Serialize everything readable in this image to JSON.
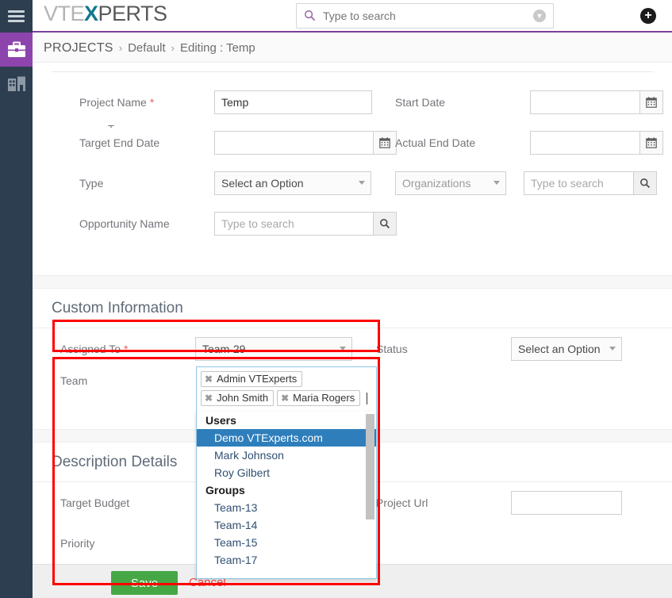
{
  "app": {
    "logo_part1": "VTE",
    "logo_x": "X",
    "logo_part2": "PERTS"
  },
  "header": {
    "search_placeholder": "Type to search",
    "search_value": "",
    "search_icon": "search-icon",
    "dropdown_icon": "chevron-down-circle-icon",
    "add_icon": "plus-circle-icon"
  },
  "sidebar": {
    "menu_icon": "hamburger-menu-icon",
    "items": [
      {
        "name": "projects",
        "icon": "briefcase-icon",
        "active": true
      },
      {
        "name": "organizations",
        "icon": "building-icon",
        "active": false
      }
    ]
  },
  "breadcrumb": {
    "module": "PROJECTS",
    "sep": "›",
    "view": "Default",
    "action": "Editing : Temp"
  },
  "form": {
    "cut_off_label": "T",
    "basic": [
      {
        "left": {
          "label": "Project Name",
          "required": true,
          "type": "text",
          "value": "Temp",
          "placeholder": ""
        },
        "right": {
          "label": "Start Date",
          "required": false,
          "type": "date",
          "value": "",
          "placeholder": "",
          "addon_icon": "calendar-icon"
        }
      },
      {
        "left": {
          "label": "Target End Date",
          "required": false,
          "type": "date",
          "value": "",
          "placeholder": "",
          "addon_icon": "calendar-icon"
        },
        "right": {
          "label": "Actual End Date",
          "required": false,
          "type": "date",
          "value": "",
          "placeholder": "",
          "addon_icon": "calendar-icon"
        }
      },
      {
        "left": {
          "label": "Type",
          "required": false,
          "type": "select",
          "value": "Select an Option"
        },
        "right": {
          "label": "",
          "required": false,
          "type": "module-search",
          "module_value": "Organizations",
          "placeholder": "Type to search",
          "addon_icon": "search-icon"
        }
      },
      {
        "left": {
          "label": "Opportunity Name",
          "required": false,
          "type": "search",
          "value": "",
          "placeholder": "Type to search",
          "addon_icon": "search-icon"
        },
        "right": null
      }
    ]
  },
  "custom_section": {
    "title": "Custom Information",
    "assigned_to": {
      "label": "Assigned To",
      "required": true,
      "value": "Team-29"
    },
    "status": {
      "label": "Status",
      "value": "Select an Option"
    },
    "team": {
      "label": "Team",
      "selected_tags": [
        {
          "label": "Admin VTExperts",
          "remove_icon": "remove-tag-icon"
        },
        {
          "label": "John Smith",
          "remove_icon": "remove-tag-icon"
        },
        {
          "label": "Maria Rogers",
          "remove_icon": "remove-tag-icon"
        }
      ],
      "dropdown": {
        "groups": [
          {
            "header": "Users",
            "options": [
              {
                "label": "Demo VTExperts.com",
                "highlighted": true
              },
              {
                "label": "Mark Johnson",
                "highlighted": false
              },
              {
                "label": "Roy Gilbert",
                "highlighted": false
              }
            ]
          },
          {
            "header": "Groups",
            "options": [
              {
                "label": "Team-13",
                "highlighted": false
              },
              {
                "label": "Team-14",
                "highlighted": false
              },
              {
                "label": "Team-15",
                "highlighted": false
              },
              {
                "label": "Team-17",
                "highlighted": false
              }
            ]
          }
        ]
      }
    }
  },
  "description_section": {
    "title": "Description Details",
    "target_budget_label": "Target Budget",
    "project_url_label": "Project Url",
    "project_url_value": "",
    "priority_label": "Priority"
  },
  "footer": {
    "save_label": "Save",
    "cancel_label": "Cancel"
  },
  "colors": {
    "brand_purple": "#8e44ad",
    "header_underline": "#7b3f9d",
    "rail_dark": "#2d3e50",
    "save_green": "#45a845",
    "cancel_red": "#f04747",
    "highlight_blue": "#2e7ebb",
    "annotation_red": "#ff0000",
    "required_star": "#f15d5d"
  }
}
